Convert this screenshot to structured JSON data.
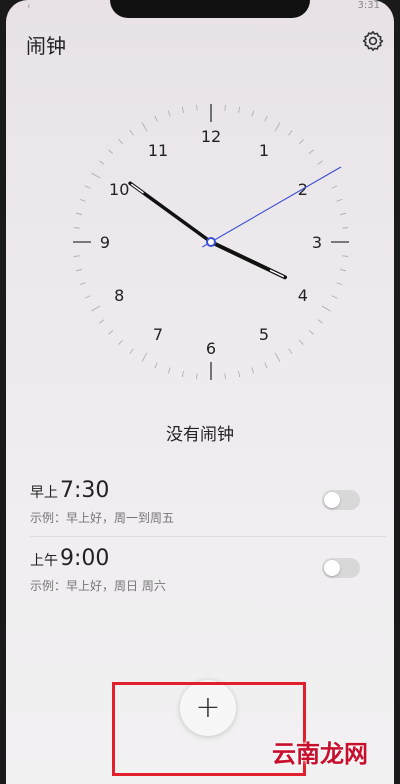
{
  "app": {
    "title": "闹钟"
  },
  "status_bar": {
    "left": "ᵢ",
    "time": "3:31"
  },
  "clock": {
    "numbers": [
      "12",
      "1",
      "2",
      "3",
      "4",
      "5",
      "6",
      "7",
      "8",
      "9",
      "10",
      "11"
    ],
    "hour": 3,
    "minute": 51,
    "second": 10,
    "hand_color": "#111111",
    "second_hand_color": "#3a4fd6"
  },
  "empty_state": {
    "text": "没有闹钟"
  },
  "alarms": [
    {
      "period": "早上",
      "time": "7:30",
      "description": "示例：早上好，周一到周五",
      "enabled": false
    },
    {
      "period": "上午",
      "time": "9:00",
      "description": "示例：早上好，周日 周六",
      "enabled": false
    }
  ],
  "fab": {
    "symbol": "+"
  },
  "watermark": {
    "text": "云南龙网"
  },
  "colors": {
    "highlight": "#e0202a",
    "watermark": "#c8102e"
  }
}
